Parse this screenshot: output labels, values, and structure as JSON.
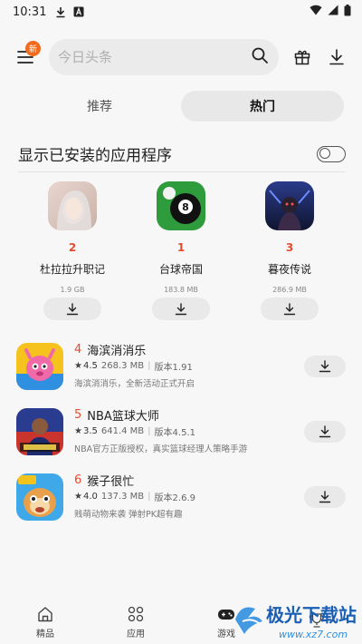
{
  "status_bar": {
    "time": "10:31",
    "icons": [
      "download-icon",
      "text-a-icon",
      "wifi-icon",
      "signal-icon",
      "battery-icon"
    ]
  },
  "header": {
    "menu_badge": "新",
    "search_placeholder": "今日头条",
    "icons": [
      "menu-icon",
      "search-icon",
      "gift-icon",
      "download-icon"
    ]
  },
  "tabs": [
    {
      "label": "推荐",
      "active": false
    },
    {
      "label": "热门",
      "active": true
    }
  ],
  "installed_toggle": {
    "label": "显示已安装的应用程序",
    "on": false
  },
  "top3": [
    {
      "rank": "2",
      "name": "杜拉拉升职记",
      "size": "1.9 GB"
    },
    {
      "rank": "1",
      "name": "台球帝国",
      "size": "183.8 MB"
    },
    {
      "rank": "3",
      "name": "暮夜传说",
      "size": "286.9 MB"
    }
  ],
  "list": [
    {
      "rank": "4",
      "name": "海滨消消乐",
      "rating": "4.5",
      "size": "268.3 MB",
      "version": "版本1.91",
      "desc": "海滨消消乐，全新活动正式开启"
    },
    {
      "rank": "5",
      "name": "NBA篮球大师",
      "rating": "3.5",
      "size": "641.4 MB",
      "version": "版本4.5.1",
      "desc": "NBA官方正版授权，真实篮球经理人策略手游"
    },
    {
      "rank": "6",
      "name": "猴子很忙",
      "rating": "4.0",
      "size": "137.3 MB",
      "version": "版本2.6.9",
      "desc": "贱萌动物来袭 弹射PK超有趣"
    }
  ],
  "bottom_nav": [
    {
      "label": "精品",
      "icon": "home-icon"
    },
    {
      "label": "应用",
      "icon": "apps-grid-icon"
    },
    {
      "label": "游戏",
      "icon": "gamepad-icon"
    },
    {
      "label": "",
      "icon": "trophy-icon"
    }
  ],
  "watermark": {
    "text": "极光下载站",
    "url": "www.xz7.com"
  },
  "colors": {
    "accent_red": "#e84a2e",
    "badge_orange": "#f26b1d"
  }
}
